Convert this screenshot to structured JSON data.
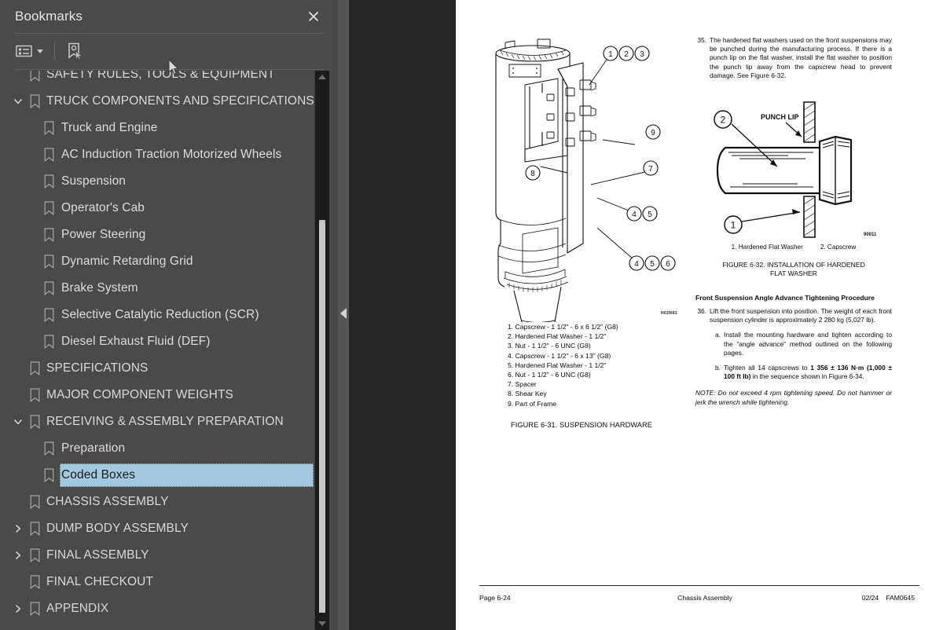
{
  "panel": {
    "title": "Bookmarks",
    "close_label": "Close",
    "toolbar": {
      "options_icon": "list-options-icon",
      "dropdown_icon": "chevron-down-icon",
      "new_bookmark_icon": "new-bookmark-icon"
    },
    "scrollbar": {
      "up_icon": "scroll-up-arrow",
      "down_icon": "scroll-down-arrow"
    },
    "items": [
      {
        "label": "SAFETY RULES, TOOLS & EQUIPMENT",
        "depth": 0,
        "twisty": "none",
        "selected": false,
        "partial": true
      },
      {
        "label": "TRUCK COMPONENTS AND SPECIFICATIONS",
        "depth": 0,
        "twisty": "expanded",
        "selected": false
      },
      {
        "label": "Truck and Engine",
        "depth": 1,
        "twisty": "none",
        "selected": false
      },
      {
        "label": "AC Induction Traction Motorized Wheels",
        "depth": 1,
        "twisty": "none",
        "selected": false
      },
      {
        "label": "Suspension",
        "depth": 1,
        "twisty": "none",
        "selected": false
      },
      {
        "label": "Operator's Cab",
        "depth": 1,
        "twisty": "none",
        "selected": false
      },
      {
        "label": "Power Steering",
        "depth": 1,
        "twisty": "none",
        "selected": false
      },
      {
        "label": "Dynamic Retarding Grid",
        "depth": 1,
        "twisty": "none",
        "selected": false
      },
      {
        "label": "Brake System",
        "depth": 1,
        "twisty": "none",
        "selected": false
      },
      {
        "label": "Selective Catalytic Reduction (SCR)",
        "depth": 1,
        "twisty": "none",
        "selected": false
      },
      {
        "label": "Diesel Exhaust Fluid (DEF)",
        "depth": 1,
        "twisty": "none",
        "selected": false
      },
      {
        "label": "SPECIFICATIONS",
        "depth": 0,
        "twisty": "none",
        "selected": false
      },
      {
        "label": "MAJOR COMPONENT WEIGHTS",
        "depth": 0,
        "twisty": "none",
        "selected": false
      },
      {
        "label": "RECEIVING & ASSEMBLY PREPARATION",
        "depth": 0,
        "twisty": "expanded",
        "selected": false
      },
      {
        "label": "Preparation",
        "depth": 1,
        "twisty": "none",
        "selected": false
      },
      {
        "label": "Coded Boxes",
        "depth": 1,
        "twisty": "none",
        "selected": true
      },
      {
        "label": "CHASSIS ASSEMBLY",
        "depth": 0,
        "twisty": "none",
        "selected": false
      },
      {
        "label": "DUMP BODY ASSEMBLY",
        "depth": 0,
        "twisty": "collapsed",
        "selected": false
      },
      {
        "label": "FINAL ASSEMBLY",
        "depth": 0,
        "twisty": "collapsed",
        "selected": false
      },
      {
        "label": "FINAL CHECKOUT",
        "depth": 0,
        "twisty": "none",
        "selected": false
      },
      {
        "label": "APPENDIX",
        "depth": 0,
        "twisty": "collapsed",
        "selected": false
      }
    ]
  },
  "splitter": {
    "collapse_icon": "collapse-left-arrow"
  },
  "document": {
    "figure_left": {
      "art_code": "H029I81",
      "parts": [
        "1. Capscrew - 1 1/2\" - 6 x 6 1/2\" (G8)",
        "2. Hardened Flat Washer - 1 1/2\"",
        "3. Nut - 1 1/2\" - 6 UNC (G8)",
        "4. Capscrew - 1 1/2\" - 6 x 13\" (G8)",
        "5. Hardened Flat Washer - 1 1/2\"",
        "6. Nut - 1 1/2\" - 6 UNC (G8)",
        "7. Spacer",
        "8. Shear Key",
        "9. Part of Frame"
      ],
      "caption": "FIGURE 6-31. SUSPENSION HARDWARE",
      "callouts": [
        "1",
        "2",
        "3",
        "9",
        "7",
        "8",
        "4",
        "5",
        "4",
        "5",
        "6"
      ]
    },
    "paragraph_35": {
      "number": "35.",
      "text": "The hardened flat washers used on the front suspensions may be punched during the manufacturing process. If there is a punch lip on the flat washer, install the flat washer to position the punch lip away from the capscrew head to prevent damage. See Figure 6-32."
    },
    "figure_right": {
      "art_code": "90011",
      "annotation": "PUNCH LIP",
      "callout_top": "2",
      "callout_bottom": "1",
      "legend": [
        "1. Hardened Flat Washer",
        "2. Capscrew"
      ],
      "caption_line1": "FIGURE 6-32. INSTALLATION OF HARDENED",
      "caption_line2": "FLAT WASHER"
    },
    "section": {
      "heading": "Front Suspension Angle Advance Tightening Procedure",
      "item36_num": "36.",
      "item36_text": "Lift the front suspension into position. The weight of each front suspension cylinder is approximately 2 280 kg (5,027 lb).",
      "item_a_num": "a.",
      "item_a_text": "Install the mounting hardware and tighten according to the “angle advance” method outlined on the following pages.",
      "item_b_num": "b.",
      "item_b_pre": "Tighten all 14 capscrews to ",
      "item_b_bold1": "1 356 ± 136 N·m (1,000 ± 100 ft lb)",
      "item_b_post": " in the sequence shown in Figure 6-34.",
      "note": "NOTE: Do not exceed 4 rpm tightening speed. Do not hammer or jerk the wrench while tightening."
    },
    "footer": {
      "left": "Page 6-24",
      "center": "Chassis Assembly",
      "right_date": "02/24",
      "right_code": "FAM0645"
    }
  }
}
